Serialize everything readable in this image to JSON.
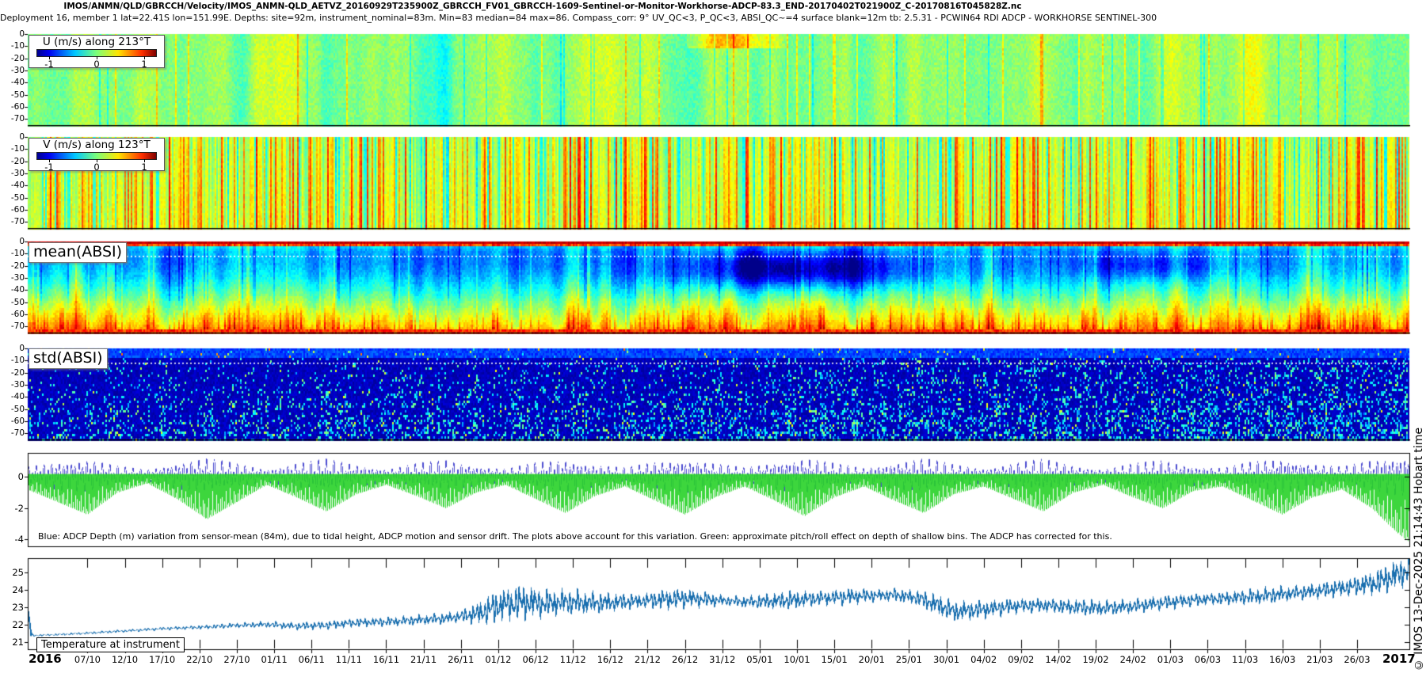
{
  "header": {
    "title_line1": "IMOS/ANMN/QLD/GBRCCH/Velocity/IMOS_ANMN-QLD_AETVZ_20160929T235900Z_GBRCCH_FV01_GBRCCH-1609-Sentinel-or-Monitor-Workhorse-ADCP-83.3_END-20170402T021900Z_C-20170816T045828Z.nc",
    "title_line2": "Deployment 16, member 1 lat=22.41S lon=151.99E. Depths: site=92m, instrument_nominal=83m. Min=83 median=84 max=86. Compass_corr: 9° UV_QC<3, P_QC<3, ABSI_QC~=4 surface blank=12m tb: 2.5.31 - PCWIN64 RDI ADCP - WORKHORSE SENTINEL-300"
  },
  "legends": {
    "u": {
      "title": "U (m/s) along 213°T",
      "ticks": [
        "-1",
        "0",
        "1"
      ]
    },
    "v": {
      "title": "V (m/s) along 123°T",
      "ticks": [
        "-1",
        "0",
        "1"
      ]
    }
  },
  "labels": {
    "mean_absi": "mean(ABSI)",
    "std_absi": "std(ABSI)",
    "temperature": "Temperature at instrument"
  },
  "caption": "Blue: ADCP Depth (m) variation from sensor-mean (84m), due to tidal height, ADCP motion and sensor drift. The plots above account for this variation. Green: approximate pitch/roll effect on depth of shallow bins. The ADCP has corrected for this.",
  "credit": "© IMOS 13-Dec-2025 21:14:43 Hobart time",
  "y_axis": {
    "depth_ticks": [
      "0",
      "-10",
      "-20",
      "-30",
      "-40",
      "-50",
      "-60",
      "-70"
    ],
    "depth_variation_ticks": [
      "0",
      "-2",
      "-4"
    ],
    "temperature_ticks": [
      "25",
      "24",
      "23",
      "22",
      "21"
    ]
  },
  "x_axis": {
    "year_left": "2016",
    "year_right": "2017",
    "date_ticks": [
      "07/10",
      "12/10",
      "17/10",
      "22/10",
      "27/10",
      "01/11",
      "06/11",
      "11/11",
      "16/11",
      "21/11",
      "26/11",
      "01/12",
      "06/12",
      "11/12",
      "16/12",
      "21/12",
      "26/12",
      "31/12",
      "05/01",
      "10/01",
      "15/01",
      "20/01",
      "25/01",
      "30/01",
      "04/02",
      "09/02",
      "14/02",
      "19/02",
      "24/02",
      "01/03",
      "06/03",
      "11/03",
      "16/03",
      "21/03",
      "26/03"
    ]
  },
  "chart_data": [
    {
      "type": "heatmap",
      "panel": 1,
      "title": "U (m/s) along 213°T",
      "x_range": [
        "29/09/2016",
        "02/04/2017"
      ],
      "depth_range_m": [
        0,
        -75
      ],
      "value_range_mps": [
        -1,
        1
      ],
      "colormap": "jet",
      "legend_position": "top-left",
      "summary": "Along-shelf velocity near zero (±0.2 m/s, green) over the whole depth and record; fine vertical tidal striping; occasional stronger positive (yellow) streaks in the upper bins around mid November."
    },
    {
      "type": "heatmap",
      "panel": 2,
      "title": "V (m/s) along 123°T",
      "x_range": [
        "29/09/2016",
        "02/04/2017"
      ],
      "depth_range_m": [
        0,
        -75
      ],
      "value_range_mps": [
        -1,
        1
      ],
      "colormap": "jet",
      "legend_position": "top-left",
      "summary": "Cross-shelf velocity with pronounced tidal column striping alternating green (≈0) with yellow/orange (≈+0.5 m/s) columns throughout the deployment."
    },
    {
      "type": "heatmap",
      "panel": 3,
      "title": "mean(ABSI)",
      "depth_range_m": [
        0,
        -75
      ],
      "colormap": "jet",
      "blank_line_depth_m": 12,
      "mean_profile_depth_vs_value": [
        [
          4,
          -0.3
        ],
        [
          8,
          -0.42
        ],
        [
          18,
          -0.44
        ],
        [
          28,
          -0.34
        ],
        [
          38,
          -0.18
        ],
        [
          48,
          0.0
        ],
        [
          58,
          0.16
        ],
        [
          66,
          0.3
        ],
        [
          72,
          0.42
        ],
        [
          75,
          0.5
        ]
      ],
      "summary": "Mean echo intensity: saturated dark-red surface bins (top ~4 m), white dotted blank line at 12 m, low backscatter (blue/cyan) 10–40 m with a darkest dark-blue patch in early January, increasing through green to yellow/orange/red streaks toward the bottom; bottom bin orange-red."
    },
    {
      "type": "heatmap",
      "panel": 4,
      "title": "std(ABSI)",
      "depth_range_m": [
        0,
        -75
      ],
      "colormap": "jet",
      "blank_line_depth_m": 12,
      "summary": "Std of echo intensity: uniformly low (dark blue) with sparse cyan/green vertical dashes that become more frequent with depth and later in the deployment; white dotted line at 12 m; lighter-blue speckled band in top bins."
    },
    {
      "type": "line",
      "panel": 5,
      "ylim": [
        -4.5,
        1.5
      ],
      "yticks": [
        0,
        -2,
        -4
      ],
      "spring_neap_period_days": 14.76,
      "semidiurnal_cycles_per_day": 1.9324,
      "series": [
        {
          "name": "ADCP Depth (m) variation from sensor-mean (84m)",
          "color": "#2d2dc8",
          "character": "semidiurnal oscillation ±1 m, spring–neap modulated",
          "amplitude_envelope_day_m": [
            [
              0,
              0.5
            ],
            [
              4,
              0.85
            ],
            [
              8,
              0.95
            ],
            [
              12,
              0.55
            ],
            [
              16,
              0.35
            ],
            [
              20,
              0.8
            ],
            [
              24,
              1.0
            ],
            [
              28,
              0.7
            ],
            [
              32,
              0.4
            ],
            [
              36,
              0.75
            ],
            [
              40,
              0.95
            ],
            [
              44,
              0.65
            ],
            [
              48,
              0.4
            ],
            [
              52,
              0.7
            ],
            [
              56,
              0.9
            ],
            [
              60,
              0.6
            ],
            [
              64,
              0.4
            ],
            [
              68,
              0.75
            ],
            [
              72,
              0.95
            ],
            [
              76,
              0.65
            ],
            [
              80,
              0.45
            ],
            [
              84,
              0.8
            ],
            [
              88,
              1.0
            ],
            [
              92,
              0.7
            ],
            [
              96,
              0.45
            ],
            [
              100,
              0.8
            ],
            [
              104,
              1.05
            ],
            [
              108,
              0.7
            ],
            [
              112,
              0.45
            ],
            [
              116,
              0.8
            ],
            [
              120,
              1.0
            ],
            [
              124,
              0.65
            ],
            [
              128,
              0.45
            ],
            [
              132,
              0.75
            ],
            [
              136,
              0.95
            ],
            [
              140,
              0.6
            ],
            [
              144,
              0.4
            ],
            [
              148,
              0.7
            ],
            [
              152,
              0.9
            ],
            [
              156,
              0.6
            ],
            [
              160,
              0.45
            ],
            [
              164,
              0.8
            ],
            [
              168,
              1.0
            ],
            [
              172,
              0.7
            ],
            [
              176,
              0.5
            ],
            [
              180,
              0.9
            ],
            [
              183,
              1.1
            ],
            [
              185,
              1.15
            ]
          ]
        },
        {
          "name": "approximate pitch/roll effect on depth of shallow bins",
          "color": "#28d228",
          "character": "downward spikes to −3 m during spring tides, to −4.4 m at record end",
          "depth_envelope_day_m": [
            [
              0,
              1.0
            ],
            [
              4,
              1.8
            ],
            [
              8,
              2.6
            ],
            [
              12,
              1.2
            ],
            [
              16,
              0.6
            ],
            [
              20,
              1.6
            ],
            [
              24,
              2.9
            ],
            [
              28,
              1.8
            ],
            [
              32,
              0.7
            ],
            [
              36,
              1.5
            ],
            [
              40,
              2.4
            ],
            [
              44,
              1.3
            ],
            [
              48,
              0.7
            ],
            [
              52,
              1.4
            ],
            [
              56,
              2.2
            ],
            [
              60,
              1.2
            ],
            [
              64,
              0.7
            ],
            [
              68,
              1.6
            ],
            [
              72,
              2.5
            ],
            [
              76,
              1.4
            ],
            [
              80,
              0.8
            ],
            [
              84,
              1.7
            ],
            [
              88,
              2.6
            ],
            [
              92,
              1.5
            ],
            [
              96,
              0.8
            ],
            [
              100,
              1.7
            ],
            [
              104,
              2.7
            ],
            [
              108,
              1.5
            ],
            [
              112,
              0.8
            ],
            [
              116,
              1.7
            ],
            [
              120,
              2.5
            ],
            [
              124,
              1.3
            ],
            [
              128,
              0.8
            ],
            [
              132,
              1.6
            ],
            [
              136,
              2.4
            ],
            [
              140,
              1.2
            ],
            [
              144,
              0.7
            ],
            [
              148,
              1.5
            ],
            [
              152,
              2.2
            ],
            [
              156,
              1.1
            ],
            [
              160,
              0.8
            ],
            [
              164,
              1.7
            ],
            [
              168,
              2.6
            ],
            [
              172,
              1.5
            ],
            [
              176,
              1.0
            ],
            [
              180,
              2.2
            ],
            [
              183,
              3.6
            ],
            [
              185,
              4.4
            ]
          ]
        }
      ]
    },
    {
      "type": "line",
      "panel": 6,
      "title": "Temperature at instrument",
      "ylabel": "°C",
      "ylim": [
        20.6,
        25.8
      ],
      "yticks": [
        21,
        22,
        23,
        24,
        25
      ],
      "series": [
        {
          "name": "Temperature (°C)",
          "color": "#1a6faf",
          "mean_points_day_degC": [
            [
              0,
              22.9
            ],
            [
              0.4,
              21.35
            ],
            [
              6,
              21.45
            ],
            [
              12,
              21.6
            ],
            [
              18,
              21.75
            ],
            [
              24,
              21.85
            ],
            [
              28,
              21.95
            ],
            [
              32,
              22.0
            ],
            [
              36,
              21.9
            ],
            [
              40,
              21.95
            ],
            [
              44,
              22.1
            ],
            [
              48,
              22.15
            ],
            [
              52,
              22.25
            ],
            [
              56,
              22.35
            ],
            [
              60,
              22.6
            ],
            [
              63,
              23.05
            ],
            [
              66,
              23.3
            ],
            [
              69,
              23.2
            ],
            [
              72,
              23.3
            ],
            [
              76,
              23.25
            ],
            [
              80,
              23.3
            ],
            [
              84,
              23.4
            ],
            [
              88,
              23.5
            ],
            [
              92,
              23.4
            ],
            [
              96,
              23.3
            ],
            [
              100,
              23.35
            ],
            [
              104,
              23.45
            ],
            [
              108,
              23.55
            ],
            [
              112,
              23.65
            ],
            [
              116,
              23.7
            ],
            [
              119,
              23.55
            ],
            [
              122,
              23.1
            ],
            [
              124,
              22.75
            ],
            [
              128,
              22.85
            ],
            [
              132,
              23.05
            ],
            [
              136,
              23.1
            ],
            [
              140,
              23.0
            ],
            [
              144,
              22.95
            ],
            [
              148,
              23.05
            ],
            [
              152,
              23.25
            ],
            [
              156,
              23.4
            ],
            [
              160,
              23.5
            ],
            [
              164,
              23.6
            ],
            [
              168,
              23.75
            ],
            [
              172,
              23.9
            ],
            [
              176,
              24.1
            ],
            [
              180,
              24.35
            ],
            [
              183,
              24.8
            ],
            [
              185,
              25.15
            ]
          ],
          "oscillation_amplitude_day_degC": [
            [
              0,
              0.04
            ],
            [
              20,
              0.07
            ],
            [
              30,
              0.12
            ],
            [
              40,
              0.18
            ],
            [
              50,
              0.2
            ],
            [
              58,
              0.25
            ],
            [
              62,
              0.65
            ],
            [
              66,
              0.75
            ],
            [
              70,
              0.55
            ],
            [
              74,
              0.5
            ],
            [
              78,
              0.4
            ],
            [
              82,
              0.3
            ],
            [
              86,
              0.45
            ],
            [
              90,
              0.35
            ],
            [
              94,
              0.2
            ],
            [
              98,
              0.3
            ],
            [
              102,
              0.4
            ],
            [
              106,
              0.3
            ],
            [
              110,
              0.35
            ],
            [
              114,
              0.25
            ],
            [
              118,
              0.3
            ],
            [
              122,
              0.45
            ],
            [
              126,
              0.4
            ],
            [
              130,
              0.35
            ],
            [
              134,
              0.3
            ],
            [
              138,
              0.3
            ],
            [
              142,
              0.35
            ],
            [
              146,
              0.3
            ],
            [
              150,
              0.3
            ],
            [
              154,
              0.3
            ],
            [
              158,
              0.25
            ],
            [
              162,
              0.3
            ],
            [
              166,
              0.35
            ],
            [
              170,
              0.3
            ],
            [
              174,
              0.35
            ],
            [
              178,
              0.4
            ],
            [
              181,
              0.55
            ],
            [
              185,
              0.65
            ]
          ]
        }
      ]
    }
  ],
  "render": {
    "seed": 7,
    "colors": {
      "tide_blue": "#2d2dc8",
      "pitch_green": "#28d228",
      "temperature_line": "#1a6faf",
      "blank_line": "#ffffff",
      "frame": "#000000"
    }
  }
}
